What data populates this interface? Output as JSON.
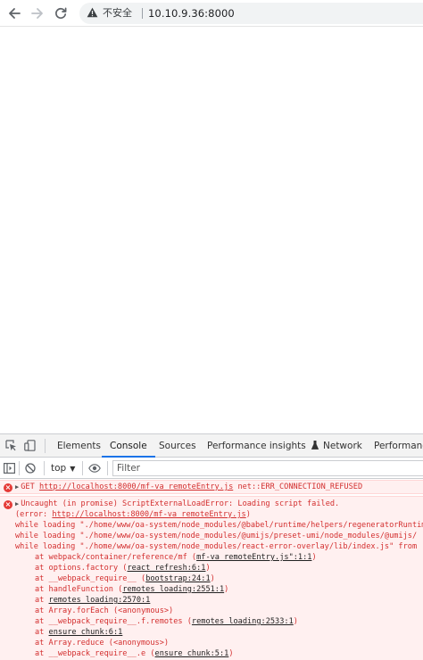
{
  "browser": {
    "nav": {
      "back_icon": "arrow-left-icon",
      "forward_icon": "arrow-right-icon",
      "reload_icon": "reload-icon"
    },
    "omnibox": {
      "warning_icon": "warning-triangle-icon",
      "security_label": "不安全",
      "url": "10.10.9.36:8000"
    }
  },
  "devtools": {
    "tabs": [
      {
        "label": "Elements"
      },
      {
        "label": "Console",
        "active": true
      },
      {
        "label": "Sources"
      },
      {
        "label": "Performance insights"
      },
      {
        "label": "Network"
      },
      {
        "label": "Performance"
      }
    ],
    "toolbar": {
      "context": "top",
      "filter_placeholder": "Filter"
    },
    "console": {
      "error1": {
        "method": "GET",
        "url": "http://localhost:8000/mf-va_remoteEntry.js",
        "status": "net::ERR_CONNECTION_REFUSED"
      },
      "error2": {
        "headline": "Uncaught (in promise) ScriptExternalLoadError: Loading script failed.",
        "error_prefix": "(error: ",
        "error_url": "http://localhost:8000/mf-va_remoteEntry.js",
        "error_suffix": ")",
        "while1": "while loading \"./home/www/oa-system/node_modules/@babel/runtime/helpers/regeneratorRuntime.js\"",
        "while2": "while loading \"./home/www/oa-system/node_modules/@umijs/preset-umi/node_modules/@umijs/",
        "while3": "while loading \"./home/www/oa-system/node_modules/react-error-overlay/lib/index.js\" from",
        "trace": [
          {
            "text": "at webpack/container/reference/mf (",
            "link": "mf-va_remoteEntry.js\":1:1",
            "end": ")"
          },
          {
            "text": "at options.factory (",
            "link": "react_refresh:6:1",
            "end": ")"
          },
          {
            "text": "at __webpack_require__ (",
            "link": "bootstrap:24:1",
            "end": ")"
          },
          {
            "text": "at handleFunction (",
            "link": "remotes_loading:2551:1",
            "end": ")"
          },
          {
            "text": "at ",
            "link": "remotes_loading:2570:1",
            "end": ""
          },
          {
            "text": "at Array.forEach (<anonymous>)",
            "link": "",
            "end": ""
          },
          {
            "text": "at __webpack_require__.f.remotes (",
            "link": "remotes_loading:2533:1",
            "end": ")"
          },
          {
            "text": "at ",
            "link": "ensure_chunk:6:1",
            "end": ""
          },
          {
            "text": "at Array.reduce (<anonymous>)",
            "link": "",
            "end": ""
          },
          {
            "text": "at __webpack_require__.e (",
            "link": "ensure_chunk:5:1",
            "end": ")"
          }
        ]
      }
    }
  }
}
